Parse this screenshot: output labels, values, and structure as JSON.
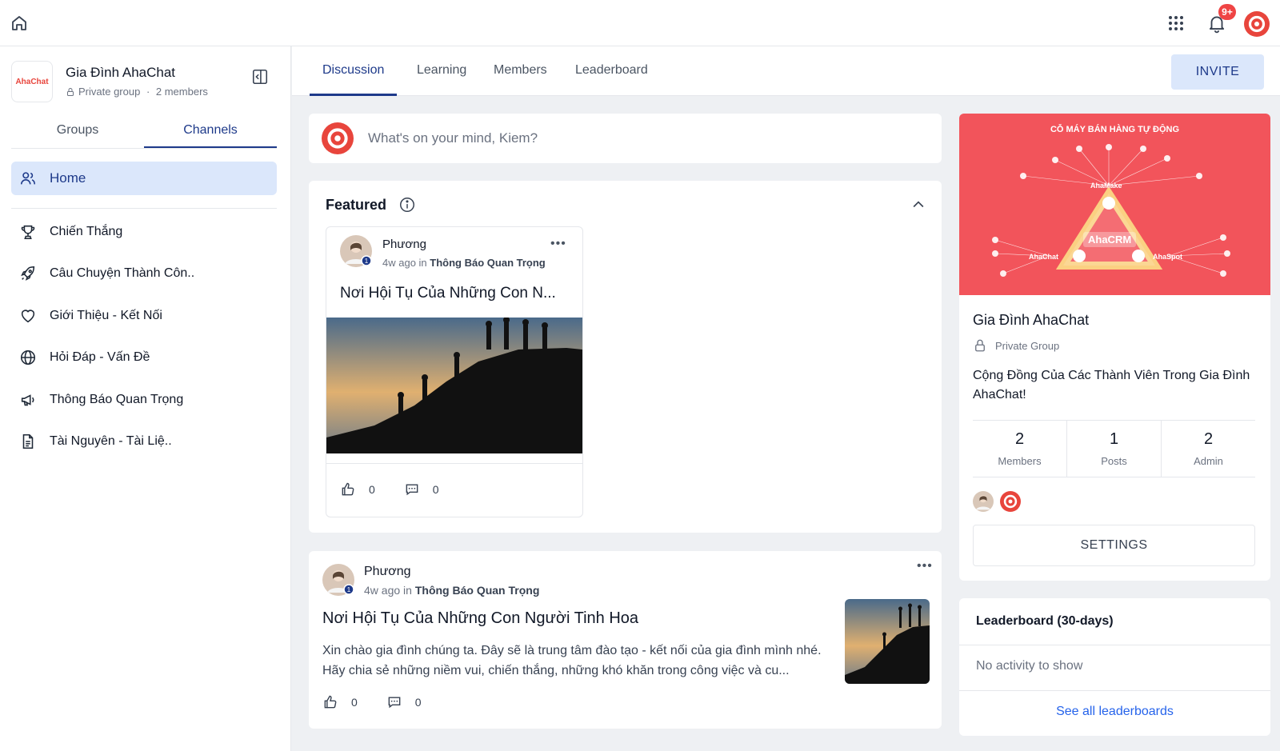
{
  "topbar": {
    "icons": [
      "home-icon",
      "apps-grid-icon",
      "bell-icon"
    ],
    "notification_badge": "9+",
    "brand_color": "#e8453c"
  },
  "group": {
    "logo_text": "AhaChat",
    "name": "Gia Đình AhaChat",
    "privacy": "Private group",
    "members": "2 members"
  },
  "sidebar": {
    "tabs": [
      "Groups",
      "Channels"
    ],
    "active_tab": "Channels",
    "home_label": "Home",
    "channels": [
      {
        "label": "Chiến Thắng",
        "icon": "trophy-icon"
      },
      {
        "label": "Câu Chuyện Thành Côn..",
        "icon": "rocket-icon"
      },
      {
        "label": "Giới Thiệu - Kết Nối",
        "icon": "heart-icon"
      },
      {
        "label": "Hỏi Đáp - Vấn Đề",
        "icon": "globe-icon"
      },
      {
        "label": "Thông Báo Quan Trọng",
        "icon": "megaphone-icon"
      },
      {
        "label": "Tài Nguyên - Tài Liệ..",
        "icon": "document-icon"
      }
    ]
  },
  "main": {
    "tabs": [
      "Discussion",
      "Learning",
      "Members",
      "Leaderboard"
    ],
    "active_tab": "Discussion",
    "invite_label": "INVITE",
    "composer_placeholder": "What's on your mind, Kiem?",
    "featured": {
      "title": "Featured",
      "card": {
        "author": "Phương",
        "time": "4w ago",
        "in_word": "in",
        "channel": "Thông Báo Quan Trọng",
        "title": "Nơi Hội Tụ Của Những Con N...",
        "likes": "0",
        "comments": "0"
      }
    },
    "post": {
      "author": "Phương",
      "time": "4w ago",
      "in_word": "in",
      "channel": "Thông Báo Quan Trọng",
      "title": "Nơi Hội Tụ Của Những Con Người Tinh Hoa",
      "excerpt": "Xin chào gia đình chúng ta. Đây sẽ là trung tâm đào tạo - kết nối của gia đình mình nhé. Hãy chia sẻ những niềm vui, chiến thắng, những khó khăn trong công việc và cu...",
      "likes": "0",
      "comments": "0"
    }
  },
  "about": {
    "banner_title": "CỖ MÁY BÁN HÀNG TỰ ĐỘNG",
    "banner_center": "AhaCRM",
    "banner_labels": [
      "AhaMake",
      "AhaChat",
      "AhaSpot"
    ],
    "banner_color": "#f2545b",
    "name": "Gia Đình AhaChat",
    "privacy": "Private Group",
    "description": "Cộng Đồng Của Các Thành Viên Trong Gia Đình AhaChat!",
    "stats": [
      {
        "value": "2",
        "label": "Members"
      },
      {
        "value": "1",
        "label": "Posts"
      },
      {
        "value": "2",
        "label": "Admin"
      }
    ],
    "settings_label": "SETTINGS"
  },
  "leaderboard": {
    "title": "Leaderboard (30-days)",
    "empty": "No activity to show",
    "link": "See all leaderboards"
  }
}
